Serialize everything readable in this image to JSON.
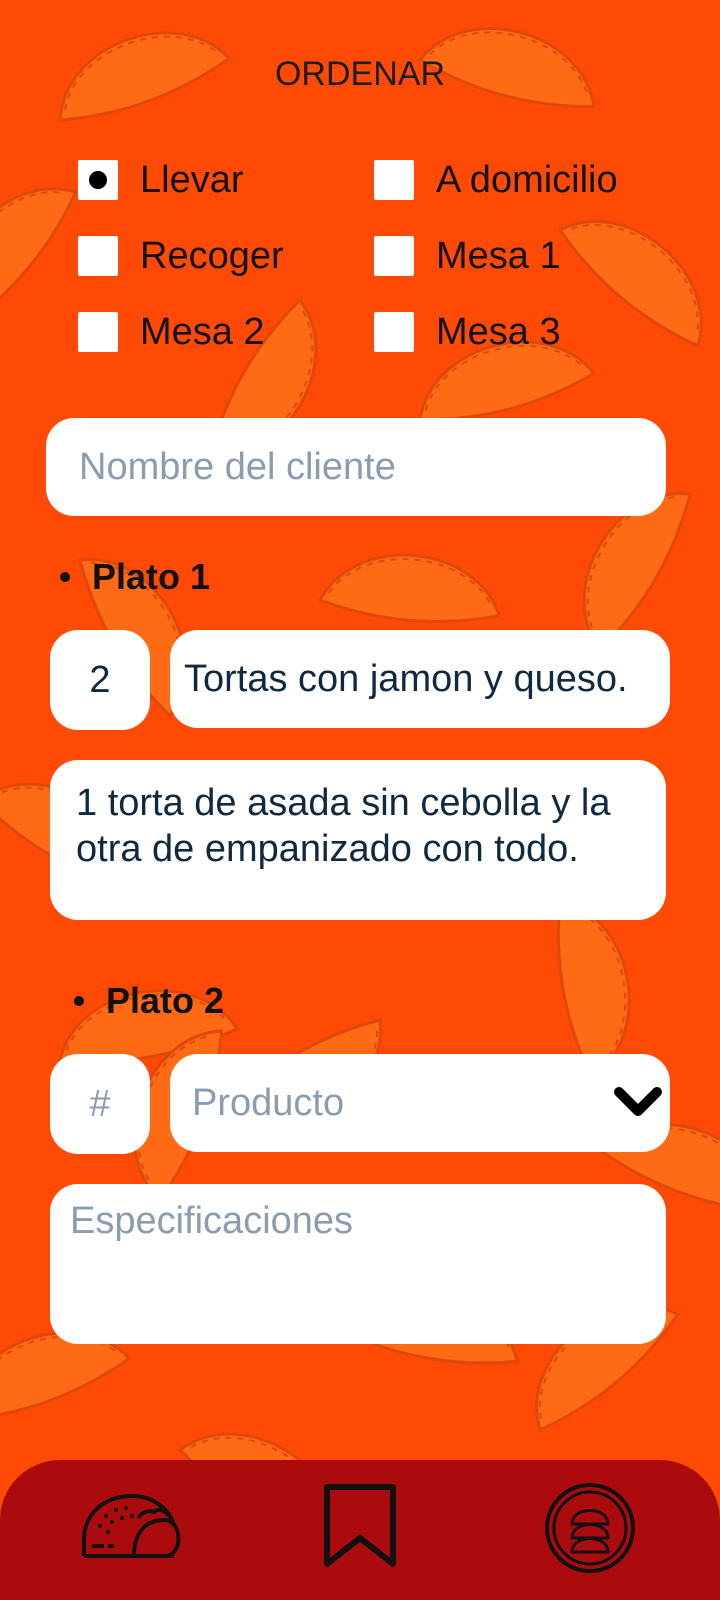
{
  "title": "ORDENAR",
  "order_types": [
    {
      "label": "Llevar",
      "selected": true
    },
    {
      "label": "A domicilio",
      "selected": false
    },
    {
      "label": "Recoger",
      "selected": false
    },
    {
      "label": "Mesa 1",
      "selected": false
    },
    {
      "label": "Mesa 2",
      "selected": false
    },
    {
      "label": "Mesa 3",
      "selected": false
    }
  ],
  "customer": {
    "placeholder": "Nombre del cliente",
    "value": ""
  },
  "platos": [
    {
      "heading": "Plato 1",
      "quantity": "2",
      "product": "Tortas con jamon y queso.",
      "spec_line1": "1 torta de asada sin cebolla y la",
      "spec_line2": "otra de empanizado con todo."
    },
    {
      "heading": "Plato 2",
      "quantity_placeholder": "#",
      "product_placeholder": "Producto",
      "spec_placeholder": "Especificaciones"
    }
  ],
  "colors": {
    "background": "#ff4a05",
    "pattern": "#ff6a14",
    "navbar": "#ac0b0e",
    "icon": "#111111",
    "field_text": "#0f2942",
    "placeholder": "#8a9db0"
  },
  "nav": [
    {
      "icon": "taco-icon"
    },
    {
      "icon": "bookmark-icon"
    },
    {
      "icon": "stacked-tacos-icon"
    }
  ]
}
